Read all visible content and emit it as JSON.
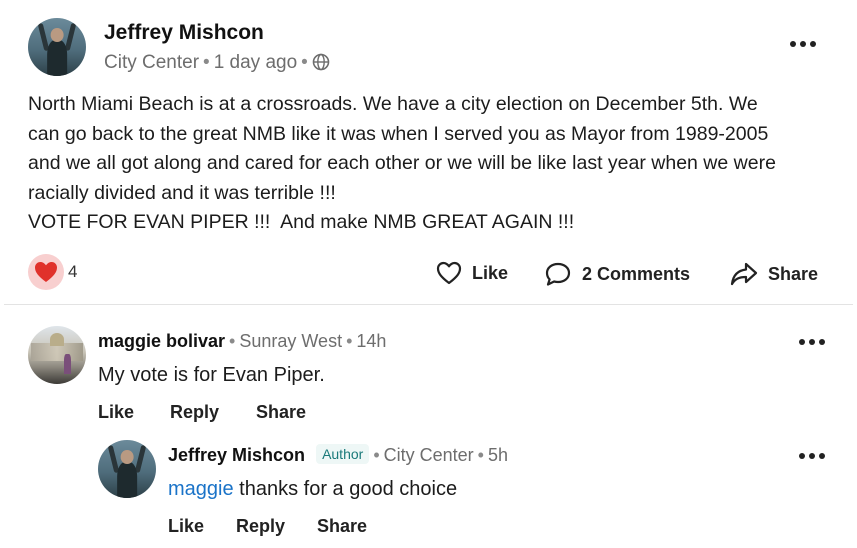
{
  "post": {
    "author": "Jeffrey Mishcon",
    "neighborhood": "City Center",
    "time": "1 day ago",
    "privacy_icon": "globe-icon",
    "body_lines": [
      "North Miami Beach is at a crossroads. We have a city election on December 5th. We",
      "can go back to the great NMB like it was when I served you as Mayor from 1989-2005",
      "and we all got along and cared for each other or we will be like last year when we were",
      "racially divided and it was terrible !!!",
      "VOTE FOR EVAN PIPER !!!  And make NMB GREAT AGAIN !!!"
    ],
    "reaction_count": "4",
    "like_label": "Like",
    "comments_label": "2 Comments",
    "share_label": "Share"
  },
  "comments": [
    {
      "author": "maggie bolivar",
      "neighborhood": "Sunray West",
      "time": "14h",
      "text": "My vote is for Evan Piper.",
      "like_label": "Like",
      "reply_label": "Reply",
      "share_label": "Share"
    }
  ],
  "reply": {
    "author": "Jeffrey Mishcon",
    "badge": "Author",
    "neighborhood": "City Center",
    "time": "5h",
    "mention": "maggie",
    "text": "thanks for a good choice",
    "like_label": "Like",
    "reply_label": "Reply",
    "share_label": "Share"
  },
  "colors": {
    "mention": "#1a73c8",
    "heart": "#e0312b",
    "heart_bg": "#f8cfcf",
    "author_badge": "#1a7a7a"
  }
}
